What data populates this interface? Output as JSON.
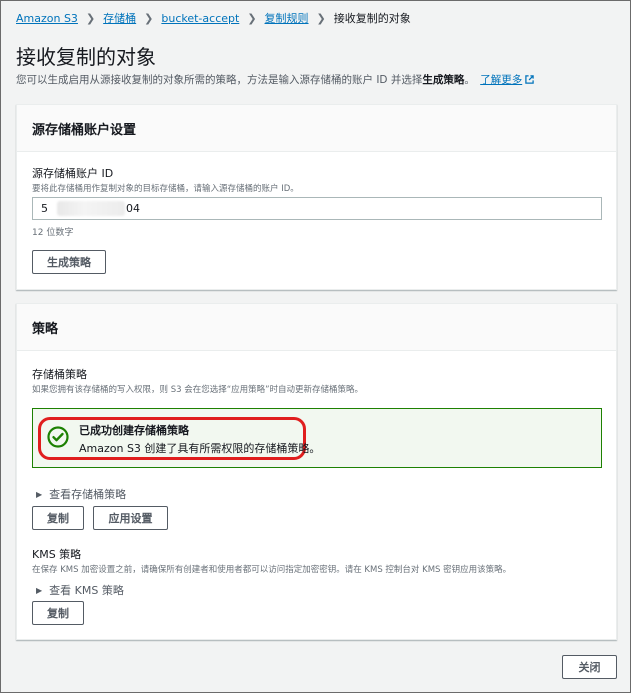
{
  "breadcrumb": {
    "items": [
      "Amazon S3",
      "存储桶",
      "bucket-accept",
      "复制规则"
    ],
    "current": "接收复制的对象"
  },
  "page": {
    "title": "接收复制的对象",
    "desc_prefix": "您可以生成启用从源接收复制的对象所需的策略，方法是输入源存储桶的账户 ID 并选择",
    "desc_bold": "生成策略",
    "desc_suffix": "。",
    "learn_more": "了解更多"
  },
  "source_panel": {
    "title": "源存储桶账户设置",
    "field_label": "源存储桶账户 ID",
    "field_hint": "要将此存储桶用作复制对象的目标存储桶，请输入源存储桶的账户 ID。",
    "value_prefix": "5",
    "value_suffix": "04",
    "constraint": "12 位数字",
    "generate_button": "生成策略"
  },
  "policy_panel": {
    "title": "策略",
    "bucket_policy_label": "存储桶策略",
    "bucket_policy_hint": "如果您拥有该存储桶的写入权限，则 S3 会在您选择“应用策略”时自动更新存储桶策略。",
    "success_title": "已成功创建存储桶策略",
    "success_text": "Amazon S3 创建了具有所需权限的存储桶策略。",
    "view_bucket_policy": "查看存储桶策略",
    "copy_button": "复制",
    "apply_button": "应用设置",
    "kms_label": "KMS 策略",
    "kms_hint": "在保存 KMS 加密设置之前，请确保所有创建者和使用者都可以访问指定加密密钥。请在 KMS 控制台对 KMS 密钥应用该策略。",
    "view_kms_policy": "查看 KMS 策略",
    "kms_copy_button": "复制"
  },
  "footer": {
    "close_button": "关闭"
  },
  "icons": {
    "check": "check-circle-icon",
    "external": "external-link-icon",
    "caret": "caret-right-icon"
  },
  "colors": {
    "link": "#0073bb",
    "success": "#1d8102",
    "highlight": "#e01e1e"
  }
}
